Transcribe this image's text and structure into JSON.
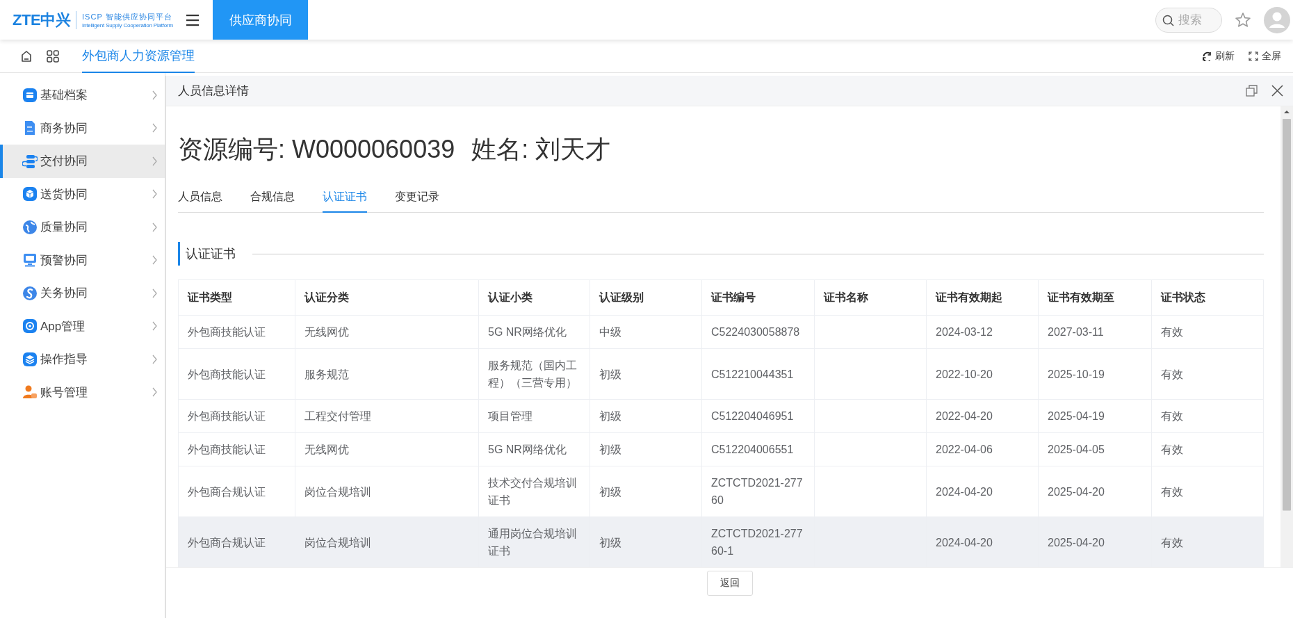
{
  "header": {
    "logo": {
      "brand": "ZTE中兴",
      "platform": "ISCP 智能供应协同平台",
      "platform_en": "Intelligent Supply Cooperation Platform"
    },
    "nav_tabs": [
      {
        "label": "供应商协同",
        "selected": true
      }
    ],
    "search": {
      "placeholder": "搜索"
    }
  },
  "toolbar": {
    "page_tabs": [
      {
        "label": "外包商人力资源管理",
        "selected": true
      }
    ],
    "actions": [
      {
        "kind": "refresh",
        "label": "刷新"
      },
      {
        "kind": "fullscreen",
        "label": "全屏"
      }
    ]
  },
  "sidebar": {
    "items": [
      {
        "label": "基础档案",
        "selected": false
      },
      {
        "label": "商务协同",
        "selected": false
      },
      {
        "label": "交付协同",
        "selected": true
      },
      {
        "label": "送货协同",
        "selected": false
      },
      {
        "label": "质量协同",
        "selected": false
      },
      {
        "label": "预警协同",
        "selected": false
      },
      {
        "label": "关务协同",
        "selected": false
      },
      {
        "label": "App管理",
        "selected": false
      },
      {
        "label": "操作指导",
        "selected": false
      },
      {
        "label": "账号管理",
        "selected": false
      }
    ]
  },
  "panel": {
    "title": "人员信息详情",
    "heading": {
      "resource_no": "资源编号: W0000060039",
      "name": "姓名: 刘天才"
    },
    "tabs": [
      {
        "label": "人员信息",
        "selected": false
      },
      {
        "label": "合规信息",
        "selected": false
      },
      {
        "label": "认证证书",
        "selected": true
      },
      {
        "label": "变更记录",
        "selected": false
      }
    ],
    "section_title": "认证证书",
    "table": {
      "columns": [
        "证书类型",
        "认证分类",
        "认证小类",
        "认证级别",
        "证书编号",
        "证书名称",
        "证书有效期起",
        "证书有效期至",
        "证书状态"
      ],
      "rows": [
        {
          "highlighted": false,
          "cells": [
            "外包商技能认证",
            "无线网优",
            "5G NR网络优化",
            "中级",
            "C5224030058878",
            "",
            "2024-03-12",
            "2027-03-11",
            "有效"
          ]
        },
        {
          "highlighted": false,
          "cells": [
            "外包商技能认证",
            "服务规范",
            "服务规范（国内工程）（三营专用）",
            "初级",
            "C512210044351",
            "",
            "2022-10-20",
            "2025-10-19",
            "有效"
          ]
        },
        {
          "highlighted": false,
          "cells": [
            "外包商技能认证",
            "工程交付管理",
            "项目管理",
            "初级",
            "C512204046951",
            "",
            "2022-04-20",
            "2025-04-19",
            "有效"
          ]
        },
        {
          "highlighted": false,
          "cells": [
            "外包商技能认证",
            "无线网优",
            "5G NR网络优化",
            "初级",
            "C512204006551",
            "",
            "2022-04-06",
            "2025-04-05",
            "有效"
          ]
        },
        {
          "highlighted": false,
          "cells": [
            "外包商合规认证",
            "岗位合规培训",
            "技术交付合规培训证书",
            "初级",
            "ZCTCTD2021-27760",
            "",
            "2024-04-20",
            "2025-04-20",
            "有效"
          ]
        },
        {
          "highlighted": true,
          "cells": [
            "外包商合规认证",
            "岗位合规培训",
            "通用岗位合规培训证书",
            "初级",
            "ZCTCTD2021-27760-1",
            "",
            "2024-04-20",
            "2025-04-20",
            "有效"
          ]
        }
      ]
    },
    "buttons": [
      "返回"
    ]
  }
}
